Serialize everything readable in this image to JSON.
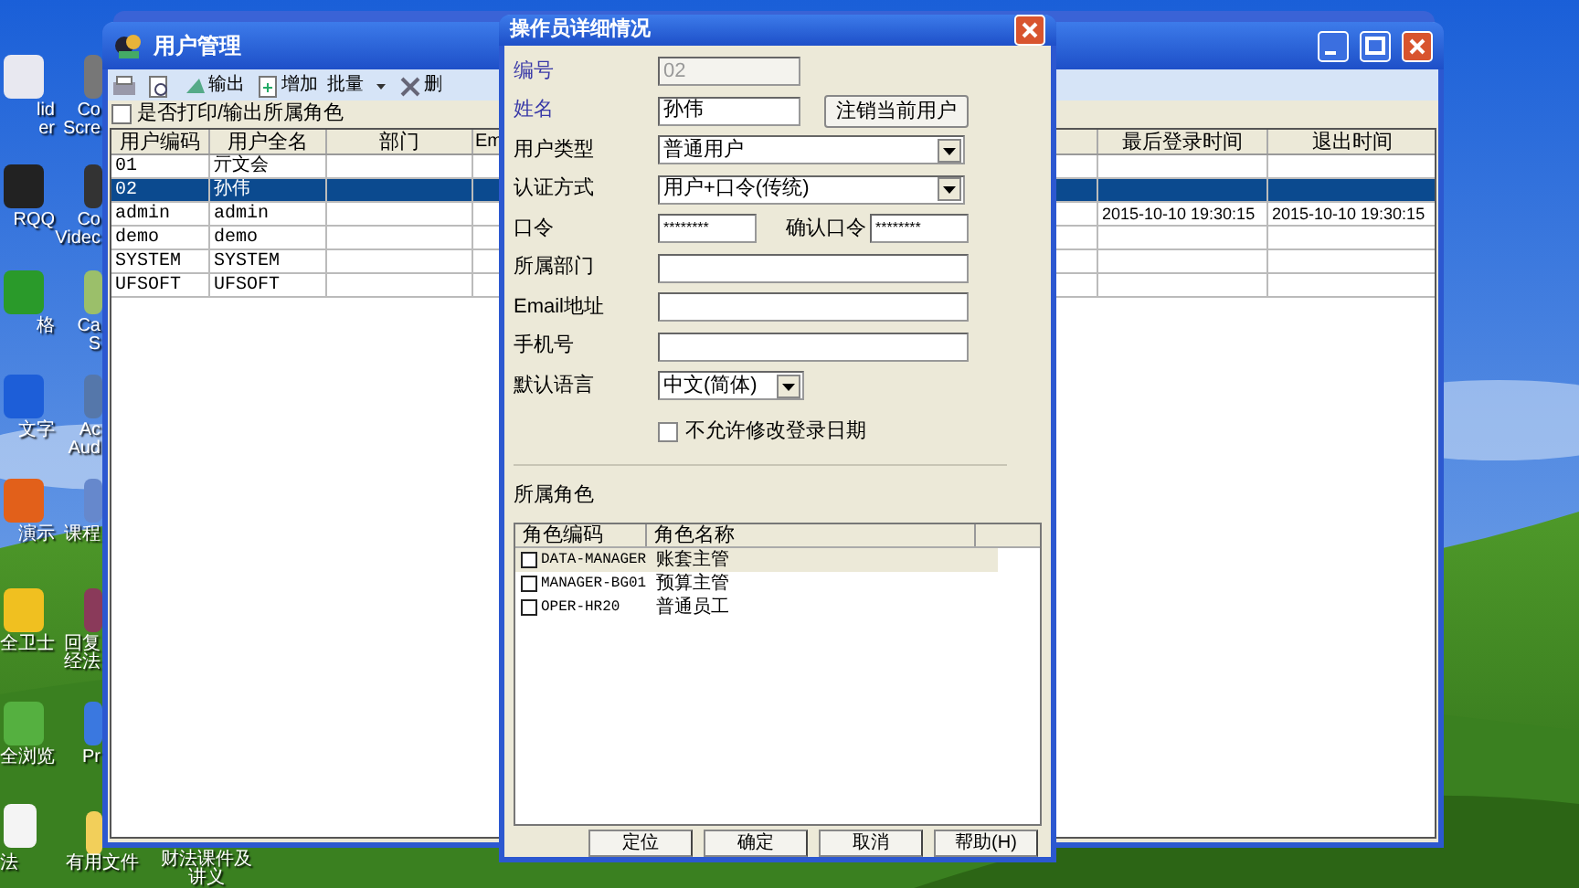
{
  "desktop_icons": [
    {
      "lines": [
        "lid",
        "er"
      ]
    },
    {
      "lines": [
        "Co",
        "Scre"
      ]
    },
    {
      "lines": [
        "RQQ"
      ]
    },
    {
      "lines": [
        "Co",
        "Videc"
      ]
    },
    {
      "lines": [
        "格"
      ]
    },
    {
      "lines": [
        "Ca",
        "S"
      ]
    },
    {
      "lines": [
        "文字"
      ]
    },
    {
      "lines": [
        "Ac",
        "Aud"
      ]
    },
    {
      "lines": [
        "演示"
      ]
    },
    {
      "lines": [
        "课程"
      ]
    },
    {
      "lines": [
        "全卫士"
      ]
    },
    {
      "lines": [
        "回复",
        "经法"
      ]
    },
    {
      "lines": [
        "全浏览"
      ]
    },
    {
      "lines": [
        "Pr"
      ]
    },
    {
      "lines": [
        "法"
      ]
    },
    {
      "lines": [
        "有用文件"
      ]
    },
    {
      "lines": [
        "财法课件及",
        "讲义"
      ]
    }
  ],
  "user_window": {
    "title": "用户管理",
    "toolbar": [
      {
        "kind": "button",
        "label": "输出"
      },
      {
        "kind": "button",
        "label": "增加"
      },
      {
        "kind": "menu",
        "label": "批量"
      },
      {
        "kind": "button",
        "label": "删"
      }
    ],
    "print_roles": {
      "label": "是否打印/输出所属角色",
      "checked": false
    },
    "table": {
      "columns": [
        "用户编码",
        "用户全名",
        "部门",
        "Em",
        "最后登录时间",
        "退出时间"
      ],
      "rows": [
        {
          "code": "01",
          "name": "亓文会",
          "selected": false
        },
        {
          "code": "02",
          "name": "孙伟",
          "selected": true
        },
        {
          "code": "admin",
          "name": "admin",
          "last_login": "2015-10-10 19:30:15",
          "logout": "2015-10-10 19:30:15",
          "selected": false
        },
        {
          "code": "demo",
          "name": "demo",
          "selected": false
        },
        {
          "code": "SYSTEM",
          "name": "SYSTEM",
          "selected": false
        },
        {
          "code": "UFSOFT",
          "name": "UFSOFT",
          "selected": false
        }
      ]
    }
  },
  "dialog": {
    "title": "操作员详细情况",
    "fields": [
      {
        "label": "编号",
        "kind": "short_text",
        "value": "02",
        "required": true,
        "disabled": true
      },
      {
        "label": "姓名",
        "kind": "short_text",
        "value": "孙伟",
        "required": true,
        "disabled": false,
        "button": "注销当前用户"
      },
      {
        "label": "用户类型",
        "kind": "select",
        "value": "普通用户",
        "required": false,
        "disabled": false
      },
      {
        "label": "认证方式",
        "kind": "select",
        "value": "用户+口令(传统)",
        "required": false,
        "disabled": false
      },
      {
        "label": "口令",
        "kind": "password",
        "value": "********",
        "confirm_label": "确认口令",
        "confirm_value": "********",
        "required": false,
        "disabled": false
      },
      {
        "label": "所属部门",
        "kind": "text",
        "required": false,
        "disabled": false
      },
      {
        "label": "Email地址",
        "kind": "text",
        "required": false,
        "disabled": false
      },
      {
        "label": "手机号",
        "kind": "text",
        "required": false,
        "disabled": false
      },
      {
        "label": "默认语言",
        "kind": "short_select",
        "value": "中文(简体)",
        "required": false,
        "disabled": false
      }
    ],
    "lock_date": {
      "label": "不允许修改登录日期",
      "checked": false
    },
    "roles": {
      "title": "所属角色",
      "columns": [
        "角色编码",
        "角色名称"
      ],
      "rows": [
        {
          "code": "DATA-MANAGER",
          "name": "账套主管",
          "checked": false,
          "selected": true
        },
        {
          "code": "MANAGER-BG01",
          "name": "预算主管",
          "checked": false,
          "selected": false
        },
        {
          "code": "OPER-HR20",
          "name": "普通员工",
          "checked": false,
          "selected": false
        }
      ]
    },
    "buttons": [
      "定位",
      "确定",
      "取消",
      "帮助(H)"
    ]
  }
}
